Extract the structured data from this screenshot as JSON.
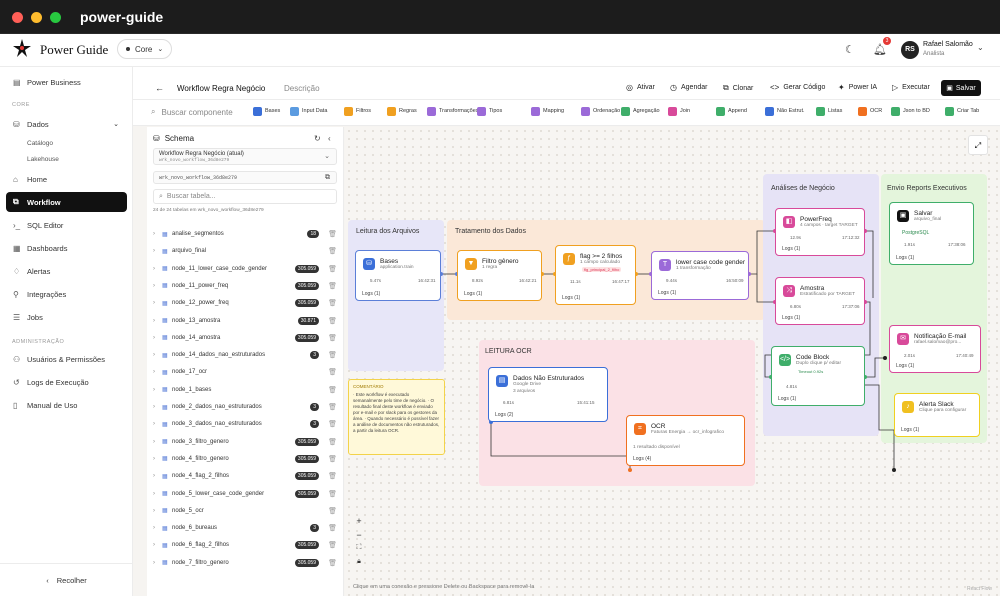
{
  "window": {
    "title": "power-guide"
  },
  "header": {
    "brand": "Power Guide",
    "context": "Core",
    "user_initials": "RS",
    "user_name": "Rafael Salomão",
    "user_role": "Analista",
    "notifications": "3"
  },
  "sidebar": {
    "power_business": "Power Business",
    "section_core": "CORE",
    "dados": "Dados",
    "catalogo": "Catálogo",
    "lakehouse": "Lakehouse",
    "home": "Home",
    "workflow": "Workflow",
    "sql_editor": "SQL Editor",
    "dashboards": "Dashboards",
    "alertas": "Alertas",
    "integracoes": "Integrações",
    "jobs": "Jobs",
    "section_admin": "ADMINISTRAÇÃO",
    "usuarios": "Usuários & Permissões",
    "logs": "Logs de Execução",
    "manual": "Manual de Uso",
    "recolher": "Recolher"
  },
  "toolbar": {
    "title": "Workflow Regra Negócio",
    "description": "Descrição",
    "ativar": "Ativar",
    "agendar": "Agendar",
    "clonar": "Clonar",
    "gerar_codigo": "Gerar Código",
    "power_ia": "Power IA",
    "executar": "Executar",
    "salvar": "Salvar"
  },
  "components": {
    "search_placeholder": "Buscar componente",
    "items": [
      {
        "label": "Bases",
        "color": "#3b6fd8"
      },
      {
        "label": "Input Data",
        "color": "#5b9be0"
      },
      {
        "label": "Filtros",
        "color": "#f0a020"
      },
      {
        "label": "Regras",
        "color": "#f0a020"
      },
      {
        "label": "Transformações",
        "color": "#9b6ad8"
      },
      {
        "label": "Tipos",
        "color": "#9b6ad8"
      },
      {
        "label": "Mapping",
        "color": "#9b6ad8"
      },
      {
        "label": "Ordenação",
        "color": "#9b6ad8"
      },
      {
        "label": "Agregação",
        "color": "#3fae6a"
      },
      {
        "label": "Join",
        "color": "#d84a9a"
      },
      {
        "label": "Append",
        "color": "#3fae6a"
      },
      {
        "label": "Não Estrut.",
        "color": "#3b6fd8"
      },
      {
        "label": "Listas",
        "color": "#3fae6a"
      },
      {
        "label": "OCR",
        "color": "#f07020"
      },
      {
        "label": "Json to BD",
        "color": "#3fae6a"
      },
      {
        "label": "Criar Tab",
        "color": "#3fae6a"
      }
    ]
  },
  "schema": {
    "title": "Schema",
    "workflow_label": "Workflow Regra Negócio (atual)",
    "workflow_id": "wrk_novo_workflow_36d8e279",
    "path": "wrk_novo_workflow_36d8e279",
    "search_placeholder": "Buscar tabela...",
    "summary": "24 de 24 tabelas em wrk_novo_workflow_36d8e279",
    "tables": [
      {
        "name": "analise_segmentos",
        "count": "18"
      },
      {
        "name": "arquivo_final",
        "count": ""
      },
      {
        "name": "node_11_lower_case_code_gender",
        "count": "305.059"
      },
      {
        "name": "node_11_power_freq",
        "count": "305.059"
      },
      {
        "name": "node_12_power_freq",
        "count": "305.059"
      },
      {
        "name": "node_13_amostra",
        "count": "30.871"
      },
      {
        "name": "node_14_amostra",
        "count": "305.059"
      },
      {
        "name": "node_14_dados_nao_estruturados",
        "count": "3"
      },
      {
        "name": "node_17_ocr",
        "count": ""
      },
      {
        "name": "node_1_bases",
        "count": ""
      },
      {
        "name": "node_2_dados_nao_estruturados",
        "count": "3"
      },
      {
        "name": "node_3_dados_nao_estruturados",
        "count": "3"
      },
      {
        "name": "node_3_filtro_genero",
        "count": "305.059"
      },
      {
        "name": "node_4_filtro_genero",
        "count": "305.059"
      },
      {
        "name": "node_4_flag_2_filhos",
        "count": "305.059"
      },
      {
        "name": "node_5_lower_case_code_gender",
        "count": "305.059"
      },
      {
        "name": "node_5_ocr",
        "count": ""
      },
      {
        "name": "node_6_bureaus",
        "count": "3"
      },
      {
        "name": "node_6_flag_2_filhos",
        "count": "305.059"
      },
      {
        "name": "node_7_filtro_genero",
        "count": "305.059"
      }
    ]
  },
  "canvas": {
    "groups": {
      "leitura": "Leitura dos Arquivos",
      "tratamento": "Tratamento dos Dados",
      "analises": "Análises de Negócio",
      "envio": "Envio Reports Executivos",
      "ocr": "LEITURA OCR"
    },
    "nodes": {
      "bases": {
        "title": "Bases",
        "sub": "application.train",
        "m1": "5.47s",
        "m2": "16:42:31",
        "logs": "Logs (1)"
      },
      "filtro": {
        "title": "Filtro gênero",
        "sub": "1 regra",
        "m1": "8.92s",
        "m2": "16:42:21",
        "logs": "Logs (1)"
      },
      "flag": {
        "title": "flag >= 2 filhos",
        "sub": "1 campo calculado",
        "tag": "flg_principal_2_filho",
        "m1": "11.1s",
        "m2": "16:47:17",
        "logs": "Logs (1)"
      },
      "lower": {
        "title": "lower case code gender",
        "sub": "1 transformação",
        "m1": "9.44s",
        "m2": "16:50:09",
        "logs": "Logs (1)"
      },
      "powerfreq": {
        "title": "PowerFreq",
        "sub": "4 campos · target TARGET",
        "m1": "12.9s",
        "m2": "17:12:32",
        "logs": "Logs (1)"
      },
      "amostra": {
        "title": "Amostra",
        "sub": "Estratificado por TARGET",
        "m1": "6.80s",
        "m2": "17:37:06",
        "logs": "Logs (1)"
      },
      "code": {
        "title": "Code Block",
        "sub": "Duplo clique p/ editar",
        "tag": "Timeout 0.92s",
        "m1": "4.81s",
        "logs": "Logs (1)"
      },
      "salvar": {
        "title": "Salvar",
        "sub": "arquivo_final",
        "db": "PostgreSQL",
        "m1": "1.91s",
        "m2": "17:38:06",
        "logs": "Logs (1)"
      },
      "email": {
        "title": "Notificação E-mail",
        "sub": "rafael.salomao@pro...",
        "m1": "2.01s",
        "m2": "17:40:49",
        "logs": "Logs (1)"
      },
      "slack": {
        "title": "Alerta Slack",
        "sub": "Clique para configurar",
        "logs": "Logs (1)"
      },
      "naoestr": {
        "title": "Dados Não Estruturados",
        "sub": "Google Drive",
        "sub2": "3 arquivos",
        "m1": "6.81s",
        "m2": "15:41:15",
        "logs": "Logs (2)"
      },
      "ocr": {
        "title": "OCR",
        "sub": "Faturas Energia → ocr_infografico",
        "sub2": "1 resultado disponível",
        "logs": "Logs (4)"
      }
    },
    "comment": {
      "label": "COMENTÁRIO",
      "text": "· Este workflow é executado semanalmente pelo time de negócio. · O resultado final deste workflow é enviado por e-mail e por slack para os gestores da área. · Quando necessário é possível fazer a análise de documentos não estruturados, a partir da leitura OCR."
    },
    "hint": "Clique em uma conexão e pressione Delete ou Backspace para removê-la",
    "attribution": "React Flow"
  }
}
